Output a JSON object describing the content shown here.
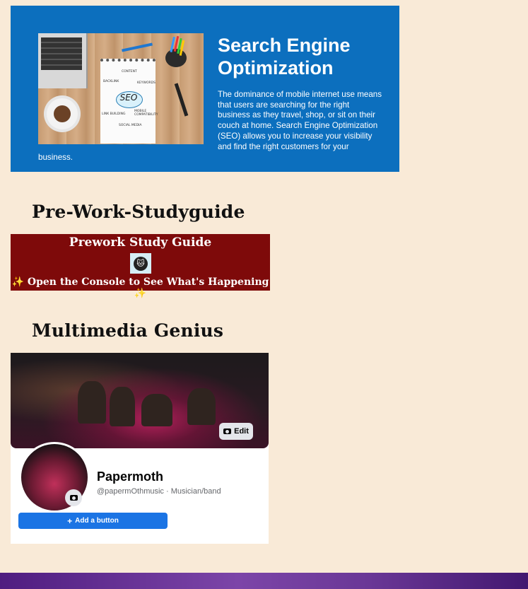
{
  "seo": {
    "title": "Search Engine Optimization",
    "description": "The dominance of mobile internet use means that users are searching for the right business as they travel, shop, or sit on their couch at home. Search Engine Optimization (SEO) allows you to increase your visibility and find the right customers for your",
    "description_tail": "business.",
    "image": {
      "center_word": "SEO",
      "notes": [
        "CONTENT",
        "BACKLINK",
        "KEYWORDS",
        "LINK BUILDING",
        "MOBILE COMPATIBILITY",
        "SOCIAL MEDIA"
      ]
    }
  },
  "prework": {
    "heading": "Pre-Work-Studyguide",
    "banner_title": "Prework Study Guide",
    "banner_subtitle": "Open the Console to See What's Happening",
    "sparkle": "✨",
    "logo_glyph": "🐱"
  },
  "multimedia": {
    "heading": "Multimedia Genius",
    "edit_label": "Edit",
    "page_name": "Papermoth",
    "page_handle": "@papermOthmusic · Musician/band",
    "add_button_label": "Add a button",
    "plus_symbol": "+"
  },
  "colors": {
    "background": "#f9ead7",
    "seo_blue": "#0c6fbe",
    "prework_red": "#7e0a0a",
    "facebook_blue": "#1b74e4",
    "footer_purple": "#5b2a8c"
  }
}
